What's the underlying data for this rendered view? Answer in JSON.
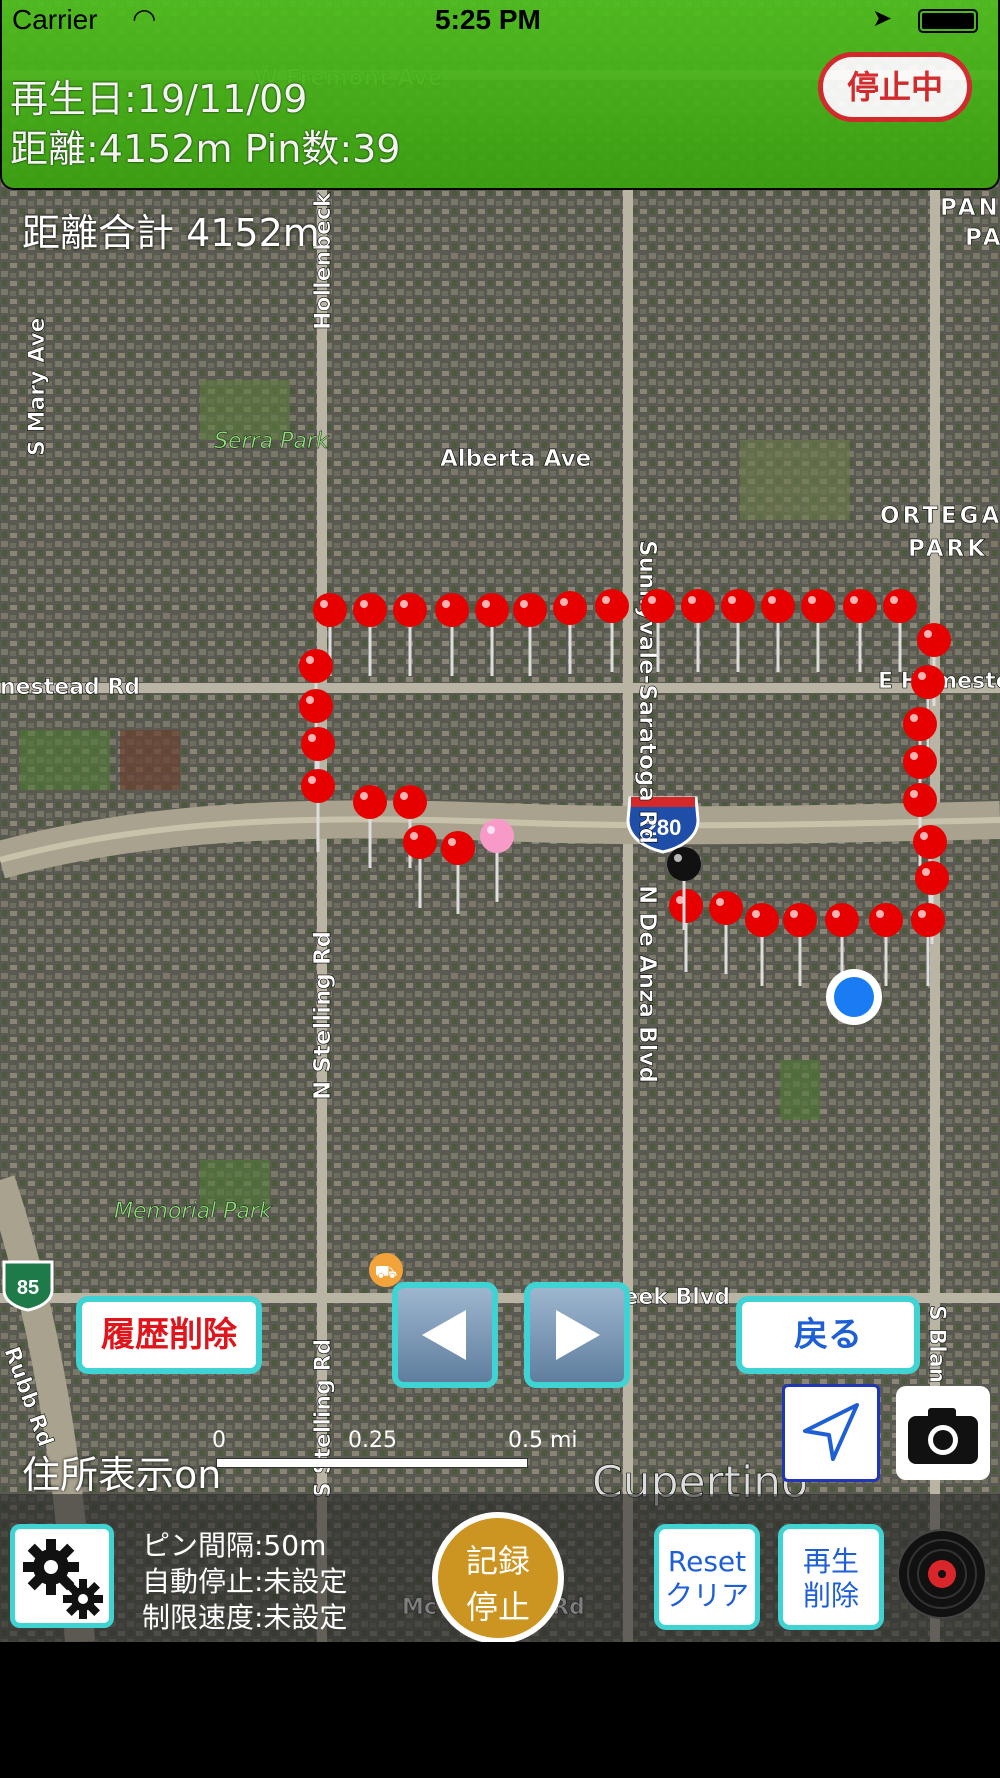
{
  "status_bar": {
    "carrier": "Carrier",
    "time": "5:25 PM"
  },
  "header": {
    "play_date": "再生日:19/11/09",
    "distance_pins": "距離:4152m Pin数:39",
    "state_badge": "停止中"
  },
  "map": {
    "distance_total": "距離合計 4152m",
    "labels": [
      "W Fremont Ave",
      "Hollenbeck",
      "Sunnyvale-Saratoga Rd",
      "S Mary Ave",
      "Serra Park",
      "Alberta Ave",
      "ORTEGA",
      "PARK",
      "PAN",
      "PA",
      "nestead Rd",
      "E Homestead",
      "280",
      "N De Anza Blvd",
      "N Stelling Rd",
      "Memorial Park",
      "85",
      "ns Creek Blvd",
      "S Blan",
      "Cupertino",
      "S Stelling Rd",
      "Rubb Rd",
      "Mc",
      "Rd"
    ],
    "scale": {
      "s0": "0",
      "s1": "0.25",
      "s2": "0.5 mi"
    },
    "pin_count": 39,
    "colors": {
      "pin": "#e60000",
      "start_pin": "#f79ac8",
      "end_pin": "#111111",
      "current_location": "#1a7cf2"
    }
  },
  "controls": {
    "history_delete": "履歴削除",
    "prev_icon": "left-triangle",
    "next_icon": "right-triangle",
    "back": "戻る",
    "address_toggle": "住所表示on"
  },
  "bottom_bar": {
    "pin_interval": "ピン間隔:50m",
    "auto_stop": "自動停止:未設定",
    "speed_limit": "制限速度:未設定",
    "record_line1": "記録",
    "record_line2": "停止",
    "reset_line1": "Reset",
    "reset_line2": "クリア",
    "playback_line1": "再生",
    "playback_line2": "削除"
  },
  "accent_color": "#3fd3d3"
}
